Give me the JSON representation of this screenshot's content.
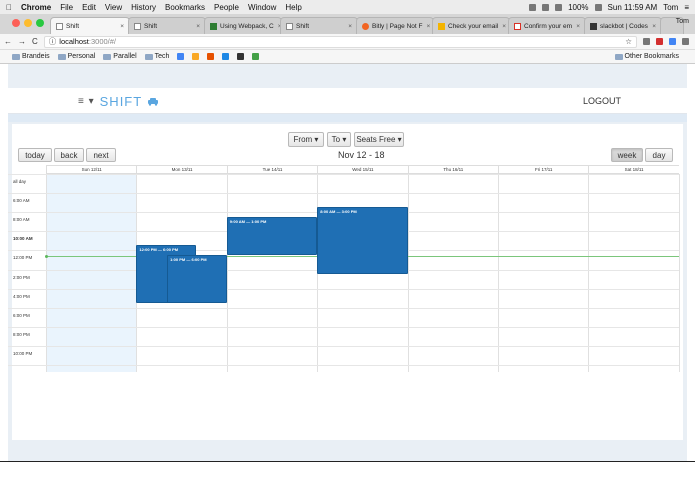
{
  "menubar": {
    "apple": "",
    "app": "Chrome",
    "items": [
      "File",
      "Edit",
      "View",
      "History",
      "Bookmarks",
      "People",
      "Window",
      "Help"
    ],
    "battery": "100%",
    "clock": "Sun 11:59 AM",
    "user": "Tom"
  },
  "tabs": [
    {
      "label": "Shift",
      "active": true
    },
    {
      "label": "Shift",
      "active": false
    },
    {
      "label": "Using Webpack, C",
      "active": false
    },
    {
      "label": "Shift",
      "active": false
    },
    {
      "label": "Bitly | Page Not F",
      "active": false
    },
    {
      "label": "Check your email",
      "active": false
    },
    {
      "label": "Confirm your em",
      "active": false
    },
    {
      "label": "slackbot | Codes",
      "active": false
    }
  ],
  "tab_user": "Tom",
  "address": {
    "host": "localhost",
    "path": ":3000/#/"
  },
  "bookmarks": [
    "Brandeis",
    "Personal",
    "Parallel",
    "Tech"
  ],
  "other_bookmarks": "Other Bookmarks",
  "app": {
    "brand": "SHIFT",
    "logout": "LOGOUT"
  },
  "toolbar": {
    "from": "From ▾",
    "to": "To ▾",
    "seats": "Seats Free ▾",
    "today": "today",
    "back": "back",
    "next": "next",
    "range": "Nov 12 - 18",
    "week": "week",
    "day": "day"
  },
  "calendar": {
    "days": [
      "Sun 12/11",
      "Mon 13/11",
      "Tue 14/11",
      "Wed 15/11",
      "Thu 16/11",
      "Fri 17/11",
      "Sat 18/11"
    ],
    "allday": "all day",
    "times": [
      "6:00 AM",
      "8:00 AM",
      "10:00 AM",
      "12:00 PM",
      "2:00 PM",
      "4:00 PM",
      "6:00 PM",
      "8:00 PM",
      "10:00 PM"
    ],
    "events": [
      {
        "label": "12:00 PM — 6:00 PM"
      },
      {
        "label": "1:00 PM — 6:00 PM"
      },
      {
        "label": "9:00 AM — 1:00 PM"
      },
      {
        "label": "8:00 AM — 3:00 PM"
      }
    ]
  },
  "colors": {
    "accent": "#5aa6e0",
    "event": "#1f6fb4",
    "now": "#7bc67b"
  }
}
